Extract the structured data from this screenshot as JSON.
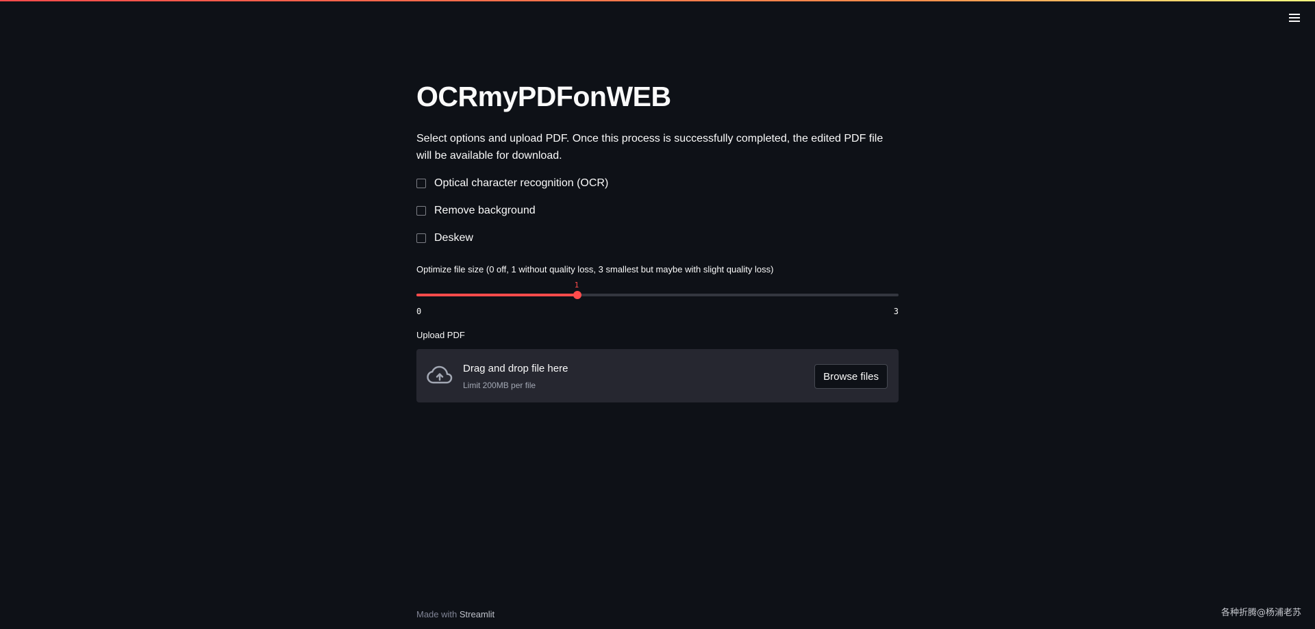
{
  "header": {
    "menu_icon": "hamburger-menu-icon",
    "accent_gradient": [
      "#ff4b4b",
      "#fffd80"
    ]
  },
  "main": {
    "title": "OCRmyPDFonWEB",
    "description": "Select options and upload PDF. Once this process is successfully completed, the edited PDF file will be available for download.",
    "checkboxes": [
      {
        "label": "Optical character recognition (OCR)",
        "checked": false
      },
      {
        "label": "Remove background",
        "checked": false
      },
      {
        "label": "Deskew",
        "checked": false
      }
    ],
    "slider": {
      "label": "Optimize file size (0 off, 1 without quality loss, 3 smallest but maybe with slight quality loss)",
      "min": "0",
      "max": "3",
      "value": "1",
      "color": "#ff4b4b"
    },
    "upload": {
      "label": "Upload PDF",
      "drop_title": "Drag and drop file here",
      "drop_limit": "Limit 200MB per file",
      "browse_label": "Browse files",
      "icon": "cloud-upload-icon"
    }
  },
  "footer": {
    "made_with": "Made with",
    "brand": "Streamlit"
  },
  "watermark": "各种折腾@杨浦老苏",
  "colors": {
    "background": "#0e1117",
    "surface": "#262730",
    "accent": "#ff4b4b"
  }
}
